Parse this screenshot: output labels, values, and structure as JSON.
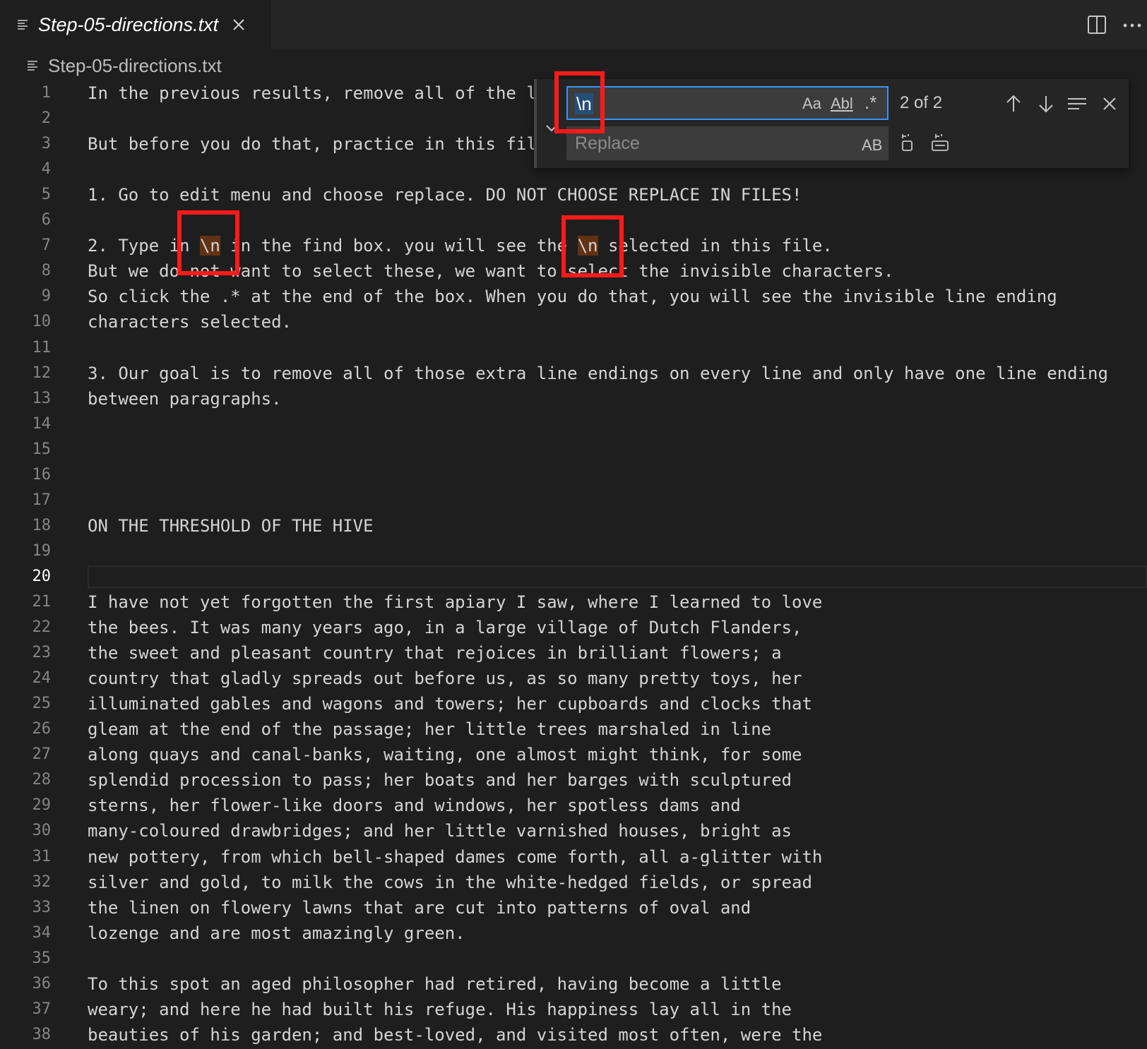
{
  "tab": {
    "title": "Step-05-directions.txt",
    "icon": "lines-icon"
  },
  "toolbar": {
    "split_icon": "split-editor-icon",
    "more_icon": "more-actions-icon"
  },
  "breadcrumb": {
    "label": "Step-05-directions.txt"
  },
  "find_widget": {
    "find_value": "\\n",
    "replace_placeholder": "Replace",
    "match_case": "Aa",
    "whole_word": "Abl",
    "regex": ".*",
    "preserve_case": "AB",
    "count": "2 of 2"
  },
  "editor": {
    "active_line": 20,
    "lines": [
      {
        "n": "1",
        "t": "In the previous results, remove all of the l"
      },
      {
        "n": "2",
        "t": ""
      },
      {
        "n": "3",
        "t": "But before you do that, practice in this fil"
      },
      {
        "n": "4",
        "t": ""
      },
      {
        "n": "5",
        "t": "1. Go to edit menu and choose replace. DO NOT CHOOSE REPLACE IN FILES!"
      },
      {
        "n": "6",
        "t": ""
      },
      {
        "n": "7",
        "t": "2. Type in \\n in the find box. you will see the \\n selected in this file."
      },
      {
        "n": "8",
        "t": "But we do not want to select these, we want to select the invisible characters."
      },
      {
        "n": "9",
        "t": "So click the .* at the end of the box. When you do that, you will see the invisible line ending"
      },
      {
        "n": "10",
        "t": "characters selected."
      },
      {
        "n": "11",
        "t": ""
      },
      {
        "n": "12",
        "t": "3. Our goal is to remove all of those extra line endings on every line and only have one line ending"
      },
      {
        "n": "13",
        "t": "between paragraphs."
      },
      {
        "n": "14",
        "t": ""
      },
      {
        "n": "15",
        "t": ""
      },
      {
        "n": "16",
        "t": ""
      },
      {
        "n": "17",
        "t": ""
      },
      {
        "n": "18",
        "t": "ON THE THRESHOLD OF THE HIVE"
      },
      {
        "n": "19",
        "t": ""
      },
      {
        "n": "20",
        "t": ""
      },
      {
        "n": "21",
        "t": "I have not yet forgotten the first apiary I saw, where I learned to love"
      },
      {
        "n": "22",
        "t": "the bees. It was many years ago, in a large village of Dutch Flanders,"
      },
      {
        "n": "23",
        "t": "the sweet and pleasant country that rejoices in brilliant flowers; a"
      },
      {
        "n": "24",
        "t": "country that gladly spreads out before us, as so many pretty toys, her"
      },
      {
        "n": "25",
        "t": "illuminated gables and wagons and towers; her cupboards and clocks that"
      },
      {
        "n": "26",
        "t": "gleam at the end of the passage; her little trees marshaled in line"
      },
      {
        "n": "27",
        "t": "along quays and canal-banks, waiting, one almost might think, for some"
      },
      {
        "n": "28",
        "t": "splendid procession to pass; her boats and her barges with sculptured"
      },
      {
        "n": "29",
        "t": "sterns, her flower-like doors and windows, her spotless dams and"
      },
      {
        "n": "30",
        "t": "many-coloured drawbridges; and her little varnished houses, bright as"
      },
      {
        "n": "31",
        "t": "new pottery, from which bell-shaped dames come forth, all a-glitter with"
      },
      {
        "n": "32",
        "t": "silver and gold, to milk the cows in the white-hedged fields, or spread"
      },
      {
        "n": "33",
        "t": "the linen on flowery lawns that are cut into patterns of oval and"
      },
      {
        "n": "34",
        "t": "lozenge and are most amazingly green."
      },
      {
        "n": "35",
        "t": ""
      },
      {
        "n": "36",
        "t": "To this spot an aged philosopher had retired, having become a little"
      },
      {
        "n": "37",
        "t": "weary; and here he had built his refuge. His happiness lay all in the"
      },
      {
        "n": "38",
        "t": "beauties of his garden; and best-loved, and visited most often, were the"
      }
    ]
  }
}
